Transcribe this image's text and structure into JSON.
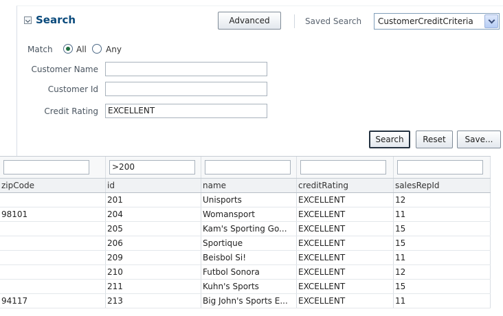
{
  "search_panel": {
    "title": "Search",
    "advanced_button": "Advanced",
    "saved_search_label": "Saved Search",
    "saved_search_value": "CustomerCreditCriteria",
    "match_label": "Match",
    "match_options": [
      "All",
      "Any"
    ],
    "match_selected": "All",
    "fields": [
      {
        "label": "Customer Name",
        "value": ""
      },
      {
        "label": "Customer Id",
        "value": ""
      },
      {
        "label": "Credit Rating",
        "value": "EXCELLENT"
      }
    ],
    "buttons": {
      "search": "Search",
      "reset": "Reset",
      "save": "Save..."
    }
  },
  "table": {
    "filters": [
      "",
      ">200",
      "",
      "",
      ""
    ],
    "columns": [
      "zipCode",
      "id",
      "name",
      "creditRating",
      "salesRepId"
    ],
    "rows": [
      [
        "",
        "201",
        "Unisports",
        "EXCELLENT",
        "12"
      ],
      [
        "98101",
        "204",
        "Womansport",
        "EXCELLENT",
        "11"
      ],
      [
        "",
        "205",
        "Kam's Sporting Go...",
        "EXCELLENT",
        "15"
      ],
      [
        "",
        "206",
        "Sportique",
        "EXCELLENT",
        "15"
      ],
      [
        "",
        "209",
        "Beisbol Si!",
        "EXCELLENT",
        "11"
      ],
      [
        "",
        "210",
        "Futbol Sonora",
        "EXCELLENT",
        "12"
      ],
      [
        "",
        "211",
        "Kuhn's Sports",
        "EXCELLENT",
        "15"
      ],
      [
        "94117",
        "213",
        "Big John's Sports E...",
        "EXCELLENT",
        "11"
      ]
    ]
  },
  "colors": {
    "title": "#0a4a7c",
    "radio_dot": "#1f6f3f"
  }
}
